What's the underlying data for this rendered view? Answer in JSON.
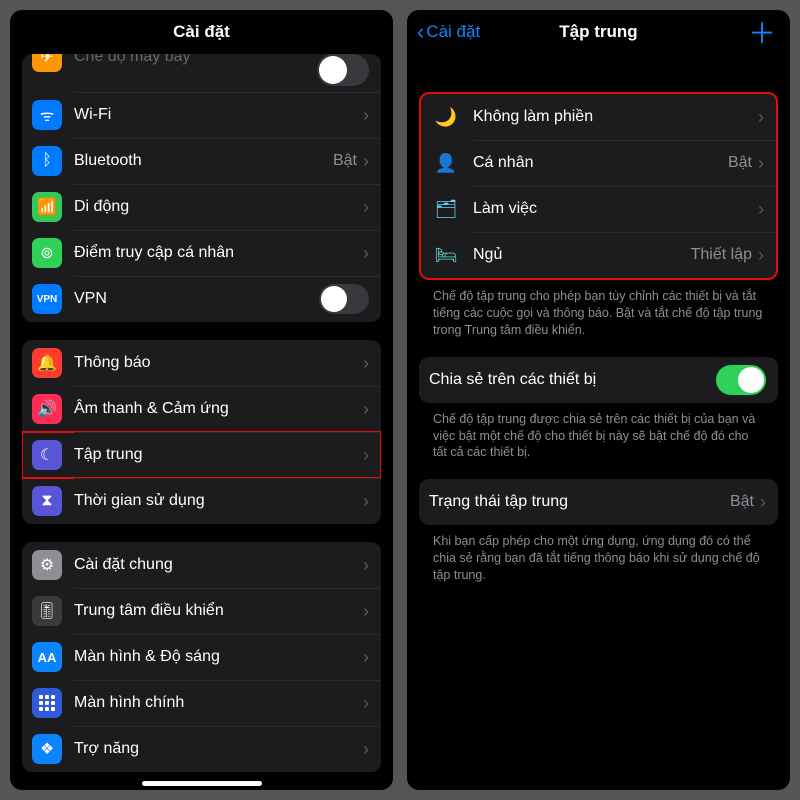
{
  "left": {
    "title": "Cài đặt",
    "groups": [
      {
        "cut_top": true,
        "rows": [
          {
            "icon": "airplane",
            "bg": "bg-orange",
            "label": "Chế độ máy bay",
            "toggle_big": true,
            "toggle_on": true
          },
          {
            "icon": "wifi",
            "bg": "bg-blue",
            "label": "Wi-Fi",
            "value": "",
            "chevron": true
          },
          {
            "icon": "bt",
            "bg": "bg-blue",
            "label": "Bluetooth",
            "value": "Bật",
            "chevron": true
          },
          {
            "icon": "cell",
            "bg": "bg-green1",
            "label": "Di động",
            "chevron": true
          },
          {
            "icon": "hotspot",
            "bg": "bg-green2",
            "label": "Điểm truy cập cá nhân",
            "chevron": true
          },
          {
            "icon": "vpn",
            "bg": "bg-vpn",
            "label": "VPN",
            "toggle": true,
            "toggle_on": false
          }
        ]
      },
      {
        "rows": [
          {
            "icon": "bell",
            "bg": "bg-red",
            "label": "Thông báo",
            "chevron": true
          },
          {
            "icon": "sound",
            "bg": "bg-pink",
            "label": "Âm thanh & Cảm ứng",
            "chevron": true
          },
          {
            "icon": "moon",
            "bg": "bg-purple",
            "label": "Tập trung",
            "chevron": true,
            "highlight": true
          },
          {
            "icon": "hourglass",
            "bg": "bg-hour",
            "label": "Thời gian sử dụng",
            "chevron": true
          }
        ]
      },
      {
        "rows": [
          {
            "icon": "gear",
            "bg": "bg-gray",
            "label": "Cài đặt chung",
            "chevron": true
          },
          {
            "icon": "sliders",
            "bg": "bg-gray2",
            "label": "Trung tâm điều khiển",
            "chevron": true
          },
          {
            "icon": "aa",
            "bg": "bg-aa",
            "label": "Màn hình & Độ sáng",
            "chevron": true
          },
          {
            "icon": "grid",
            "bg": "bg-grid",
            "label": "Màn hình chính",
            "chevron": true
          },
          {
            "icon": "acc",
            "bg": "bg-acc",
            "label": "Trợ năng",
            "chevron": true
          }
        ]
      }
    ]
  },
  "right": {
    "back": "Cài đặt",
    "title": "Tập trung",
    "focus_rows": [
      {
        "glyph": "🌙",
        "cls": "c-purple",
        "label": "Không làm phiền",
        "chevron": true
      },
      {
        "glyph": "👤",
        "cls": "c-pink",
        "label": "Cá nhân",
        "value": "Bật",
        "chevron": true
      },
      {
        "glyph": "🗂",
        "cls": "c-teal",
        "label": "Làm việc",
        "chevron": true
      },
      {
        "glyph": "🛏",
        "cls": "c-mint",
        "label": "Ngủ",
        "value": "Thiết lập",
        "chevron": true
      }
    ],
    "focus_footer": "Chế độ tập trung cho phép bạn tùy chỉnh các thiết bị và tắt tiếng các cuộc gọi và thông báo. Bật và tắt chế độ tập trung trong Trung tâm điều khiển.",
    "share_label": "Chia sẻ trên các thiết bị",
    "share_footer": "Chế độ tập trung được chia sẻ trên các thiết bị của bạn và việc bật một chế độ cho thiết bị này sẽ bật chế độ đó cho tất cả các thiết bị.",
    "status_label": "Trạng thái tập trung",
    "status_value": "Bật",
    "status_footer": "Khi bạn cấp phép cho một ứng dụng, ứng dụng đó có thể chia sẻ rằng bạn đã tắt tiếng thông báo khi sử dụng chế độ tập trung."
  }
}
